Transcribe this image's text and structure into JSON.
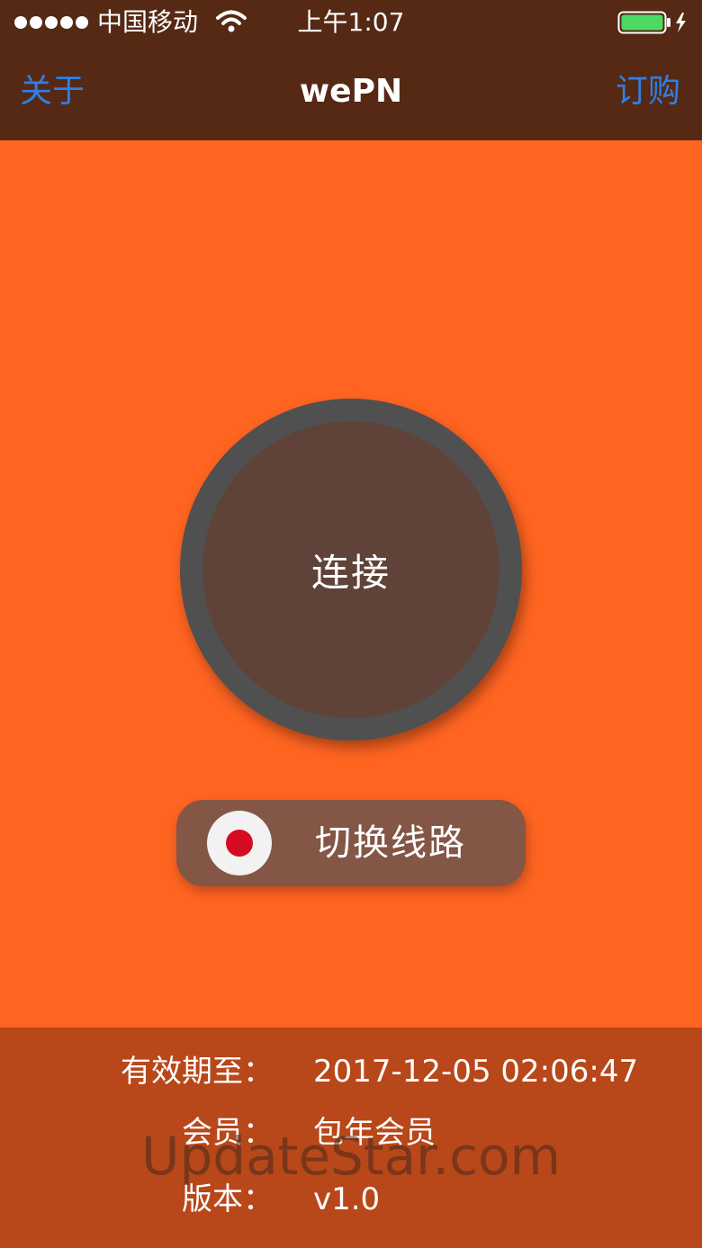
{
  "status_bar": {
    "carrier": "中国移动",
    "time": "上午1:07",
    "signal_icon": "signal-dots-icon",
    "wifi_icon": "wifi-icon",
    "battery_icon": "battery-charging-icon",
    "battery_color": "#4cd964"
  },
  "nav": {
    "left_label": "关于",
    "title": "wePN",
    "right_label": "订购",
    "link_color": "#2f7fe8",
    "bar_color": "#552914"
  },
  "main": {
    "background_color": "#ff6421",
    "connect_label": "连接",
    "switch_line_label": "切换线路",
    "flag_icon": "japan-flag-icon"
  },
  "info": {
    "expiry_label": "有效期至：",
    "expiry_value": "2017-12-05 02:06:47",
    "member_label": "会员：",
    "member_value": "包年会员",
    "version_label": "版本：",
    "version_value": "v1.0"
  },
  "watermark": "UpdateStar.com"
}
